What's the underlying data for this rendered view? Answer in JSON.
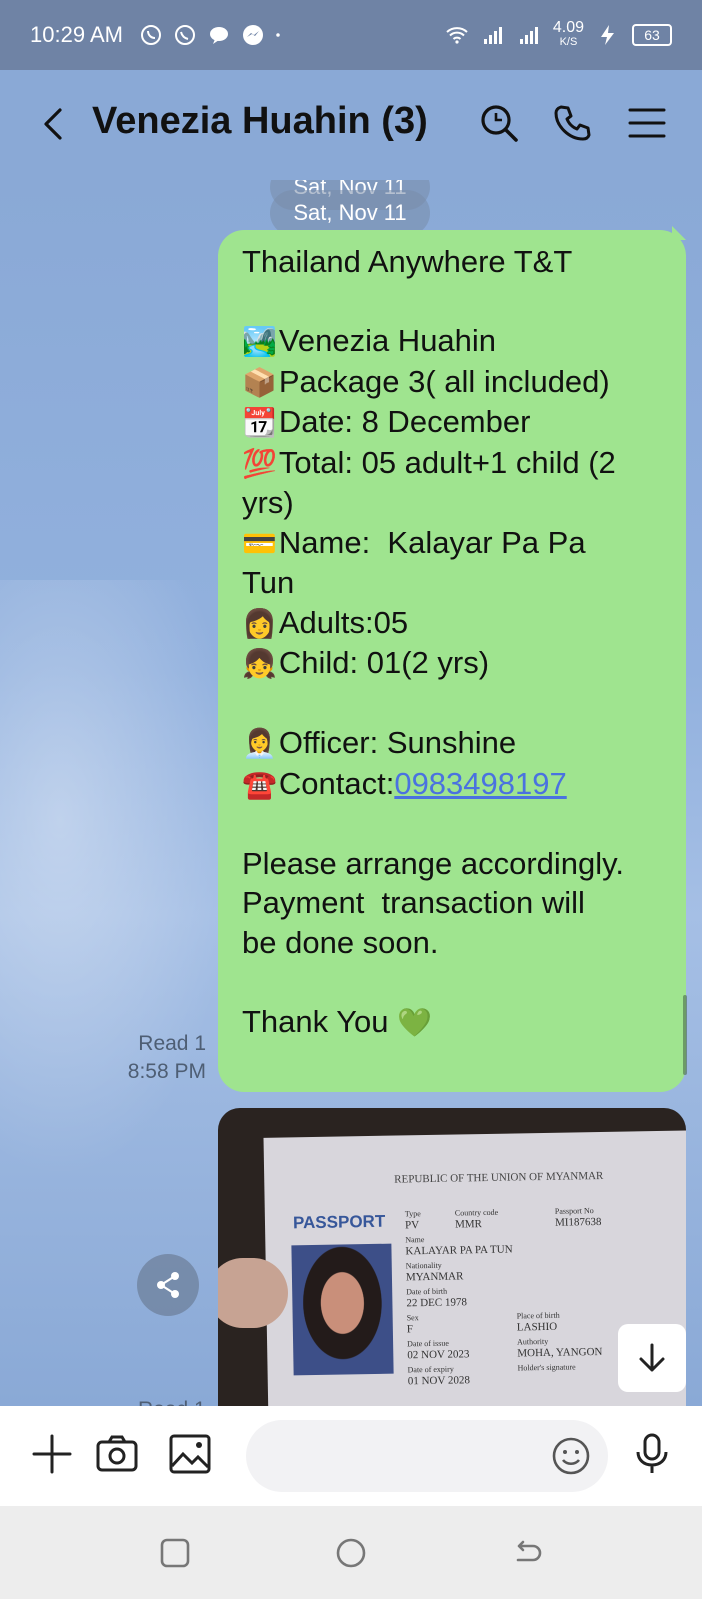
{
  "status_bar": {
    "time": "10:29 AM",
    "speed_value": "4.09",
    "speed_unit": "K/S",
    "battery": "63"
  },
  "header": {
    "title": "Venezia Huahin (3)"
  },
  "chat": {
    "date_pill_top": "Sat, Nov 11",
    "date_pill": "Sat, Nov 11",
    "message": {
      "line1": "Thailand Anywhere T&T",
      "line2": "Venezia Huahin",
      "line3": "Package 3( all included)",
      "line4": "Date: 8 December",
      "line5": "Total: 05 adult+1 child (2",
      "line6": "yrs)",
      "line7": "Name:  Kalayar Pa Pa",
      "line8": "Tun",
      "line9": "Adults:05",
      "line10": "Child: 01(2 yrs)",
      "line11": "Officer: Sunshine",
      "line12_prefix": "Contact:",
      "line12_link": "0983498197",
      "line13": "Please arrange accordingly.",
      "line14": "Payment  transaction will",
      "line15": "be done soon.",
      "line16": "Thank You",
      "emoji": {
        "e2": "🏞️",
        "e3": "📦",
        "e4": "📆",
        "e5": "💯",
        "e7": "💳",
        "e9": "👩",
        "e10": "👧",
        "e11": "👩‍💼",
        "e12": "☎️",
        "e16": "💚"
      }
    },
    "read_label": "Read 1",
    "read_time": "8:58 PM",
    "read_label_2": "Read 1",
    "photo": {
      "header": "REPUBLIC OF THE UNION OF MYANMAR",
      "word": "PASSPORT",
      "type_label": "Type",
      "type": "PV",
      "country_label": "Country code",
      "country": "MMR",
      "passport_no_label": "Passport No",
      "passport_no": "MI187638",
      "name_label": "Name",
      "name": "KALAYAR PA PA TUN",
      "nationality_label": "Nationality",
      "nationality": "MYANMAR",
      "dob_label": "Date of birth",
      "dob": "22 DEC 1978",
      "sex_label": "Sex",
      "sex": "F",
      "pob_label": "Place of birth",
      "pob": "LASHIO",
      "issue_label": "Date of issue",
      "issue": "02 NOV 2023",
      "authority_label": "Authority",
      "authority": "MOHA, YANGON",
      "expiry_label": "Date of expiry",
      "expiry": "01 NOV 2028",
      "signature_label": "Holder's signature"
    }
  },
  "input": {
    "placeholder": ""
  }
}
